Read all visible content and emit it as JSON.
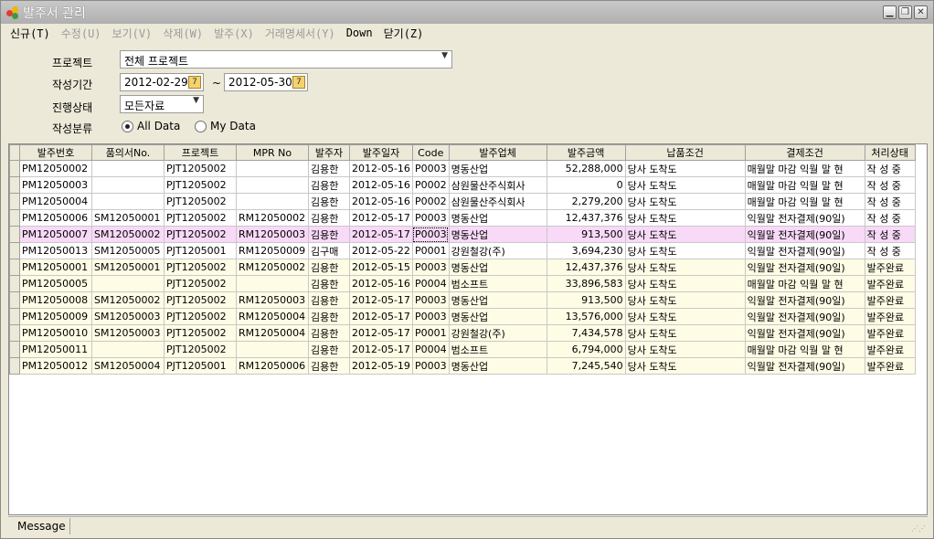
{
  "window": {
    "title": "발주서 관리"
  },
  "menu": [
    {
      "label": "신규(T)",
      "enabled": true
    },
    {
      "label": "수정(U)",
      "enabled": false
    },
    {
      "label": "보기(V)",
      "enabled": false
    },
    {
      "label": "삭제(W)",
      "enabled": false
    },
    {
      "label": "발주(X)",
      "enabled": false
    },
    {
      "label": "거래명세서(Y)",
      "enabled": false
    },
    {
      "label": "Down",
      "enabled": true
    },
    {
      "label": "닫기(Z)",
      "enabled": true
    }
  ],
  "filters": {
    "project_label": "프로젝트",
    "project_value": "전체 프로젝트",
    "period_label": "작성기간",
    "date_from": "2012-02-29",
    "date_sep": "~",
    "date_to": "2012-05-30",
    "status_label": "진행상태",
    "status_value": "모든자료",
    "category_label": "작성분류",
    "radio_all": "All Data",
    "radio_my": "My Data"
  },
  "grid": {
    "columns": [
      "발주번호",
      "품의서No.",
      "프로젝트",
      "MPR No",
      "발주자",
      "발주일자",
      "Code",
      "발주업체",
      "발주금액",
      "납품조건",
      "결제조건",
      "처리상태"
    ],
    "rows": [
      {
        "style": "white",
        "cells": [
          "PM12050002",
          "",
          "PJT1205002",
          "",
          "김용한",
          "2012-05-16",
          "P0003",
          "명동산업",
          "52,288,000",
          "당사 도착도",
          "매월말 마감 익월 말 현",
          "작 성 중"
        ]
      },
      {
        "style": "white",
        "cells": [
          "PM12050003",
          "",
          "PJT1205002",
          "",
          "김용한",
          "2012-05-16",
          "P0002",
          "삼원물산주식회사",
          "0",
          "당사 도착도",
          "매월말 마감 익월 말 현",
          "작 성 중"
        ]
      },
      {
        "style": "white",
        "cells": [
          "PM12050004",
          "",
          "PJT1205002",
          "",
          "김용한",
          "2012-05-16",
          "P0002",
          "삼원물산주식회사",
          "2,279,200",
          "당사 도착도",
          "매월말 마감 익월 말 현",
          "작 성 중"
        ]
      },
      {
        "style": "white",
        "cells": [
          "PM12050006",
          "SM12050001",
          "PJT1205002",
          "RM12050002",
          "김용한",
          "2012-05-17",
          "P0003",
          "명동산업",
          "12,437,376",
          "당사 도착도",
          "익월말 전자결제(90일)",
          "작 성 중"
        ]
      },
      {
        "style": "pink",
        "cells": [
          "PM12050007",
          "SM12050002",
          "PJT1205002",
          "RM12050003",
          "김용한",
          "2012-05-17",
          "P0003",
          "명동산업",
          "913,500",
          "당사 도착도",
          "익월말 전자결제(90일)",
          "작 성 중"
        ]
      },
      {
        "style": "white",
        "cells": [
          "PM12050013",
          "SM12050005",
          "PJT1205001",
          "RM12050009",
          "김구매",
          "2012-05-22",
          "P0001",
          "강원철강(주)",
          "3,694,230",
          "당사 도착도",
          "익월말 전자결제(90일)",
          "작 성 중"
        ]
      },
      {
        "style": "yellow",
        "cells": [
          "PM12050001",
          "SM12050001",
          "PJT1205002",
          "RM12050002",
          "김용한",
          "2012-05-15",
          "P0003",
          "명동산업",
          "12,437,376",
          "당사 도착도",
          "익월말 전자결제(90일)",
          "발주완료"
        ]
      },
      {
        "style": "yellow",
        "cells": [
          "PM12050005",
          "",
          "PJT1205002",
          "",
          "김용한",
          "2012-05-16",
          "P0004",
          "범소프트",
          "33,896,583",
          "당사 도착도",
          "매월말 마감 익월 말 현",
          "발주완료"
        ]
      },
      {
        "style": "yellow",
        "cells": [
          "PM12050008",
          "SM12050002",
          "PJT1205002",
          "RM12050003",
          "김용한",
          "2012-05-17",
          "P0003",
          "명동산업",
          "913,500",
          "당사 도착도",
          "익월말 전자결제(90일)",
          "발주완료"
        ]
      },
      {
        "style": "yellow",
        "cells": [
          "PM12050009",
          "SM12050003",
          "PJT1205002",
          "RM12050004",
          "김용한",
          "2012-05-17",
          "P0003",
          "명동산업",
          "13,576,000",
          "당사 도착도",
          "익월말 전자결제(90일)",
          "발주완료"
        ]
      },
      {
        "style": "yellow",
        "cells": [
          "PM12050010",
          "SM12050003",
          "PJT1205002",
          "RM12050004",
          "김용한",
          "2012-05-17",
          "P0001",
          "강원철강(주)",
          "7,434,578",
          "당사 도착도",
          "익월말 전자결제(90일)",
          "발주완료"
        ]
      },
      {
        "style": "yellow",
        "cells": [
          "PM12050011",
          "",
          "PJT1205002",
          "",
          "김용한",
          "2012-05-17",
          "P0004",
          "범소프트",
          "6,794,000",
          "당사 도착도",
          "매월말 마감 익월 말 현",
          "발주완료"
        ]
      },
      {
        "style": "yellow",
        "cells": [
          "PM12050012",
          "SM12050004",
          "PJT1205001",
          "RM12050006",
          "김용한",
          "2012-05-19",
          "P0003",
          "명동산업",
          "7,245,540",
          "당사 도착도",
          "익월말 전자결제(90일)",
          "발주완료"
        ]
      }
    ]
  },
  "status": {
    "message_label": "Message"
  },
  "colors": {
    "row_white": "#ffffff",
    "row_yellow": "#fefce5",
    "row_pink": "#f8d9f7",
    "chrome": "#ece9d8"
  }
}
